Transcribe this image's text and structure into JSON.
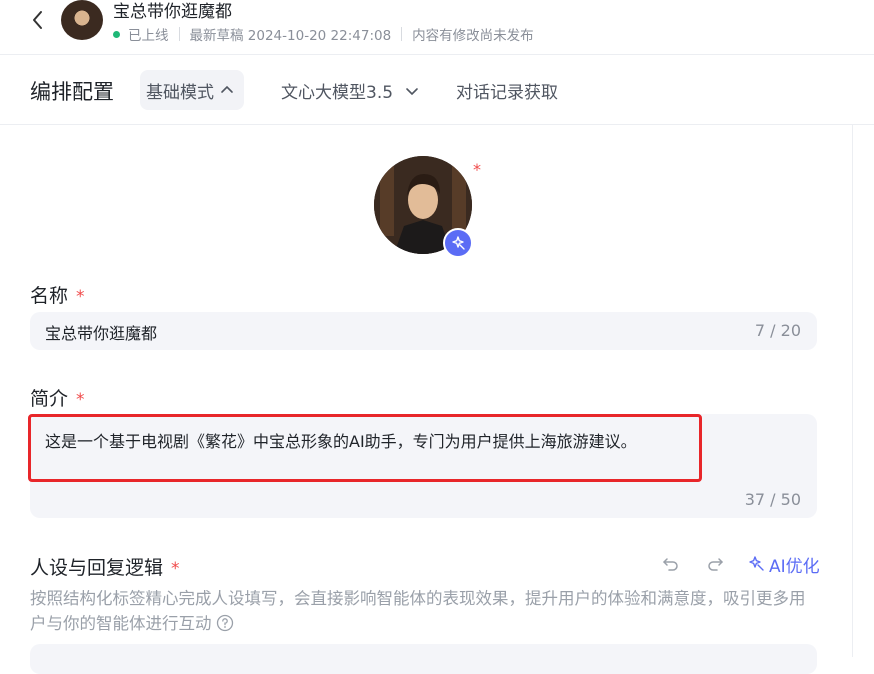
{
  "header": {
    "title": "宝总带你逛魔都",
    "status": "已上线",
    "draft": "最新草稿 2024-10-20 22:47:08",
    "unpublished": "内容有修改尚未发布",
    "status_color": "#1fb877"
  },
  "toolbar": {
    "title": "编排配置",
    "mode": "基础模式",
    "model": "文心大模型3.5",
    "record": "对话记录获取"
  },
  "form": {
    "avatar_required": "*",
    "name": {
      "label": "名称",
      "required": "*",
      "value": "宝总带你逛魔都",
      "counter": "7 / 20"
    },
    "intro": {
      "label": "简介",
      "required": "*",
      "value": "这是一个基于电视剧《繁花》中宝总形象的AI助手，专门为用户提供上海旅游建议。",
      "counter": "37 / 50"
    },
    "persona": {
      "label": "人设与回复逻辑",
      "required": "*",
      "ai_optimize": "AI优化",
      "description": "按照结构化标签精心完成人设填写，会直接影响智能体的表现效果，提升用户的体验和满意度，吸引更多用户与你的智能体进行互动"
    }
  },
  "colors": {
    "accent": "#5b6cf5",
    "required": "#f04b4b",
    "highlight": "#e8262a"
  },
  "icons": [
    "back-arrow-icon",
    "chevron-up-icon",
    "chevron-down-icon",
    "magic-wand-icon",
    "undo-icon",
    "redo-icon",
    "help-circle-icon"
  ]
}
